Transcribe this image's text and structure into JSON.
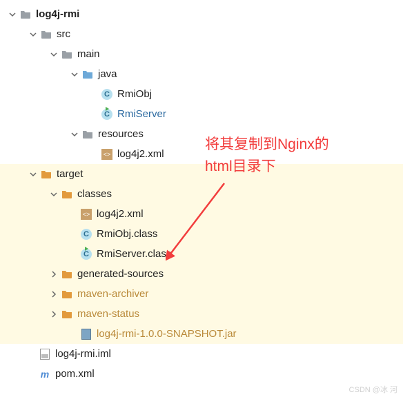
{
  "tree": {
    "root": {
      "label": "log4j-rmi",
      "icon": "folder-gray",
      "expanded": true,
      "bold": true,
      "indent": 10
    },
    "src": {
      "label": "src",
      "icon": "folder-gray",
      "expanded": true,
      "indent": 40
    },
    "main": {
      "label": "main",
      "icon": "folder-gray",
      "expanded": true,
      "indent": 70
    },
    "java": {
      "label": "java",
      "icon": "folder-blue",
      "expanded": true,
      "indent": 100
    },
    "rmiobj": {
      "label": "RmiObj",
      "icon": "java-c",
      "indent": 146
    },
    "rmiserver": {
      "label": "RmiServer",
      "icon": "java-c",
      "runnable": true,
      "indent": 146
    },
    "resources": {
      "label": "resources",
      "icon": "folder-gray",
      "expanded": true,
      "indent": 100
    },
    "log4j2xml": {
      "label": "log4j2.xml",
      "icon": "xml",
      "indent": 146
    },
    "target": {
      "label": "target",
      "icon": "folder-orange",
      "expanded": true,
      "indent": 40,
      "hl": true
    },
    "classes": {
      "label": "classes",
      "icon": "folder-orange",
      "expanded": true,
      "indent": 70,
      "hl": true
    },
    "log4j2xml2": {
      "label": "log4j2.xml",
      "icon": "xml",
      "indent": 116,
      "hl": true
    },
    "rmiobjclass": {
      "label": "RmiObj.class",
      "icon": "java-c",
      "indent": 116,
      "hl": true
    },
    "rmiserverclass": {
      "label": "RmiServer.class",
      "icon": "java-c",
      "runnable_icon": true,
      "indent": 116,
      "hl": true
    },
    "gensrc": {
      "label": "generated-sources",
      "icon": "folder-orange",
      "collapsed": true,
      "indent": 70,
      "hl": true
    },
    "mavenarch": {
      "label": "maven-archiver",
      "icon": "folder-orange",
      "collapsed": true,
      "indent": 70,
      "hl": true,
      "gen": true
    },
    "mavenstatus": {
      "label": "maven-status",
      "icon": "folder-orange",
      "collapsed": true,
      "indent": 70,
      "hl": true,
      "gen": true
    },
    "jar": {
      "label": "log4j-rmi-1.0.0-SNAPSHOT.jar",
      "icon": "jar",
      "indent": 116,
      "hl": true,
      "gen": true
    },
    "iml": {
      "label": "log4j-rmi.iml",
      "icon": "iml",
      "indent": 56
    },
    "pom": {
      "label": "pom.xml",
      "icon": "pom",
      "indent": 56
    }
  },
  "annotation": {
    "line1": "将其复制到Nginx的",
    "line2": "html目录下"
  },
  "watermark": "CSDN @冰 河"
}
